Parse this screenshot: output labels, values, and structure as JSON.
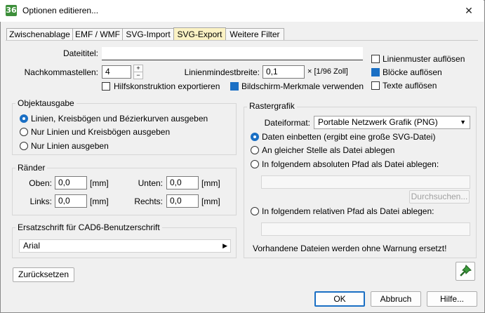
{
  "window": {
    "title": "Optionen editieren..."
  },
  "tabs": [
    {
      "label": "Zwischenablage"
    },
    {
      "label": "EMF / WMF"
    },
    {
      "label": "SVG-Import"
    },
    {
      "label": "SVG-Export"
    },
    {
      "label": "Weitere Filter"
    }
  ],
  "top": {
    "dateititel_label": "Dateititel:",
    "dateititel_value": "",
    "nachkomma_label": "Nachkommastellen:",
    "nachkomma_value": "4",
    "linienmin_label": "Linienmindestbreite:",
    "linienmin_value": "0,1",
    "linienmin_unit": "× [1/96 Zoll]",
    "hilfs_label": "Hilfskonstruktion exportieren",
    "bildschirm_label": "Bildschirm-Merkmale verwenden",
    "linienmuster_label": "Linienmuster auflösen",
    "bloecke_label": "Blöcke auflösen",
    "texte_label": "Texte auflösen"
  },
  "objektausgabe": {
    "title": "Objektausgabe",
    "options": [
      "Linien, Kreisbögen und Bézierkurven ausgeben",
      "Nur Linien und Kreisbögen ausgeben",
      "Nur Linien ausgeben"
    ]
  },
  "raender": {
    "title": "Ränder",
    "oben_label": "Oben:",
    "oben_value": "0,0",
    "unten_label": "Unten:",
    "unten_value": "0,0",
    "links_label": "Links:",
    "links_value": "0,0",
    "rechts_label": "Rechts:",
    "rechts_value": "0,0",
    "unit": "[mm]"
  },
  "ersatz": {
    "title": "Ersatzschrift für CAD6-Benutzerschrift",
    "value": "Arial"
  },
  "rastergrafik": {
    "title": "Rastergrafik",
    "format_label": "Dateiformat:",
    "format_value": "Portable Netzwerk Grafik (PNG)",
    "options": [
      "Daten einbetten (ergibt eine große SVG-Datei)",
      "An gleicher Stelle als Datei ablegen",
      "In folgendem absoluten Pfad als Datei ablegen:",
      "In folgendem relativen Pfad als Datei ablegen:"
    ],
    "browse_label": "Durchsuchen...",
    "warning": "Vorhandene Dateien werden ohne Warnung ersetzt!"
  },
  "buttons": {
    "reset": "Zurücksetzen",
    "ok": "OK",
    "cancel": "Abbruch",
    "help": "Hilfe..."
  },
  "colors": {
    "accent": "#1a6fc4",
    "active_tab": "#fbf2c4",
    "app_icon": "#3d8f3a"
  }
}
